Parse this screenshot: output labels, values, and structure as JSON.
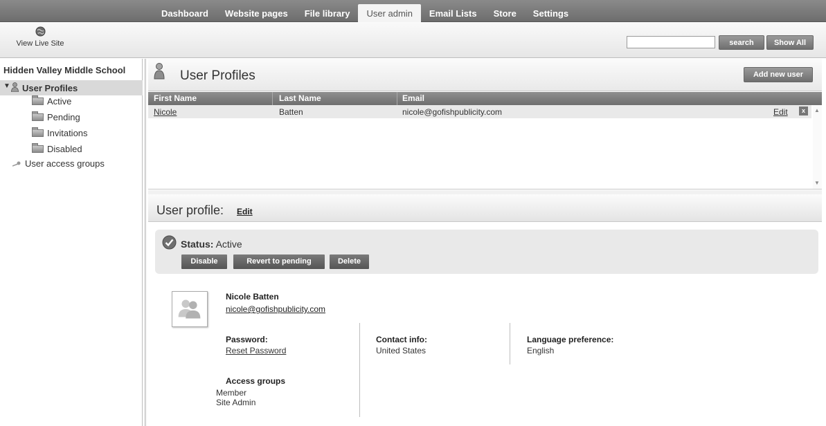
{
  "nav": {
    "tabs": [
      {
        "label": "Dashboard"
      },
      {
        "label": "Website pages"
      },
      {
        "label": "File library"
      },
      {
        "label": "User admin"
      },
      {
        "label": "Email Lists"
      },
      {
        "label": "Store"
      },
      {
        "label": "Settings"
      }
    ],
    "active_tab": "User admin"
  },
  "toolbar": {
    "view_live_site": "View Live Site",
    "search_value": "",
    "search_label": "search",
    "show_all_label": "Show All"
  },
  "sidebar": {
    "school": "Hidden Valley Middle School",
    "user_profiles": "User Profiles",
    "items": [
      {
        "label": "Active"
      },
      {
        "label": "Pending"
      },
      {
        "label": "Invitations"
      },
      {
        "label": "Disabled"
      }
    ],
    "access_groups": "User access groups"
  },
  "main": {
    "title": "User Profiles",
    "add_new_user": "Add new user",
    "columns": [
      "First Name",
      "Last Name",
      "Email"
    ],
    "rows": [
      {
        "first": "Nicole",
        "last": "Batten",
        "email": "nicole@gofishpublicity.com",
        "edit": "Edit",
        "delete": "x"
      }
    ]
  },
  "profile": {
    "heading": "User profile:",
    "edit": "Edit",
    "status_label": "Status:",
    "status_value": "Active",
    "buttons": {
      "disable": "Disable",
      "revert": "Revert to pending",
      "delete": "Delete"
    },
    "name": "Nicole Batten",
    "email": "nicole@gofishpublicity.com",
    "password_label": "Password:",
    "password_action": "Reset Password",
    "contact_label": "Contact info:",
    "contact_value": "United States",
    "language_label": "Language preference:",
    "language_value": "English",
    "access_label": "Access groups",
    "access_groups": [
      "Member",
      "Site Admin"
    ]
  },
  "colors": {
    "nav_bg": "#7a7a7a",
    "button_dark": "#6f6f6f",
    "row_bg": "#e9e9e9",
    "status_bg": "#e9e9e9"
  }
}
